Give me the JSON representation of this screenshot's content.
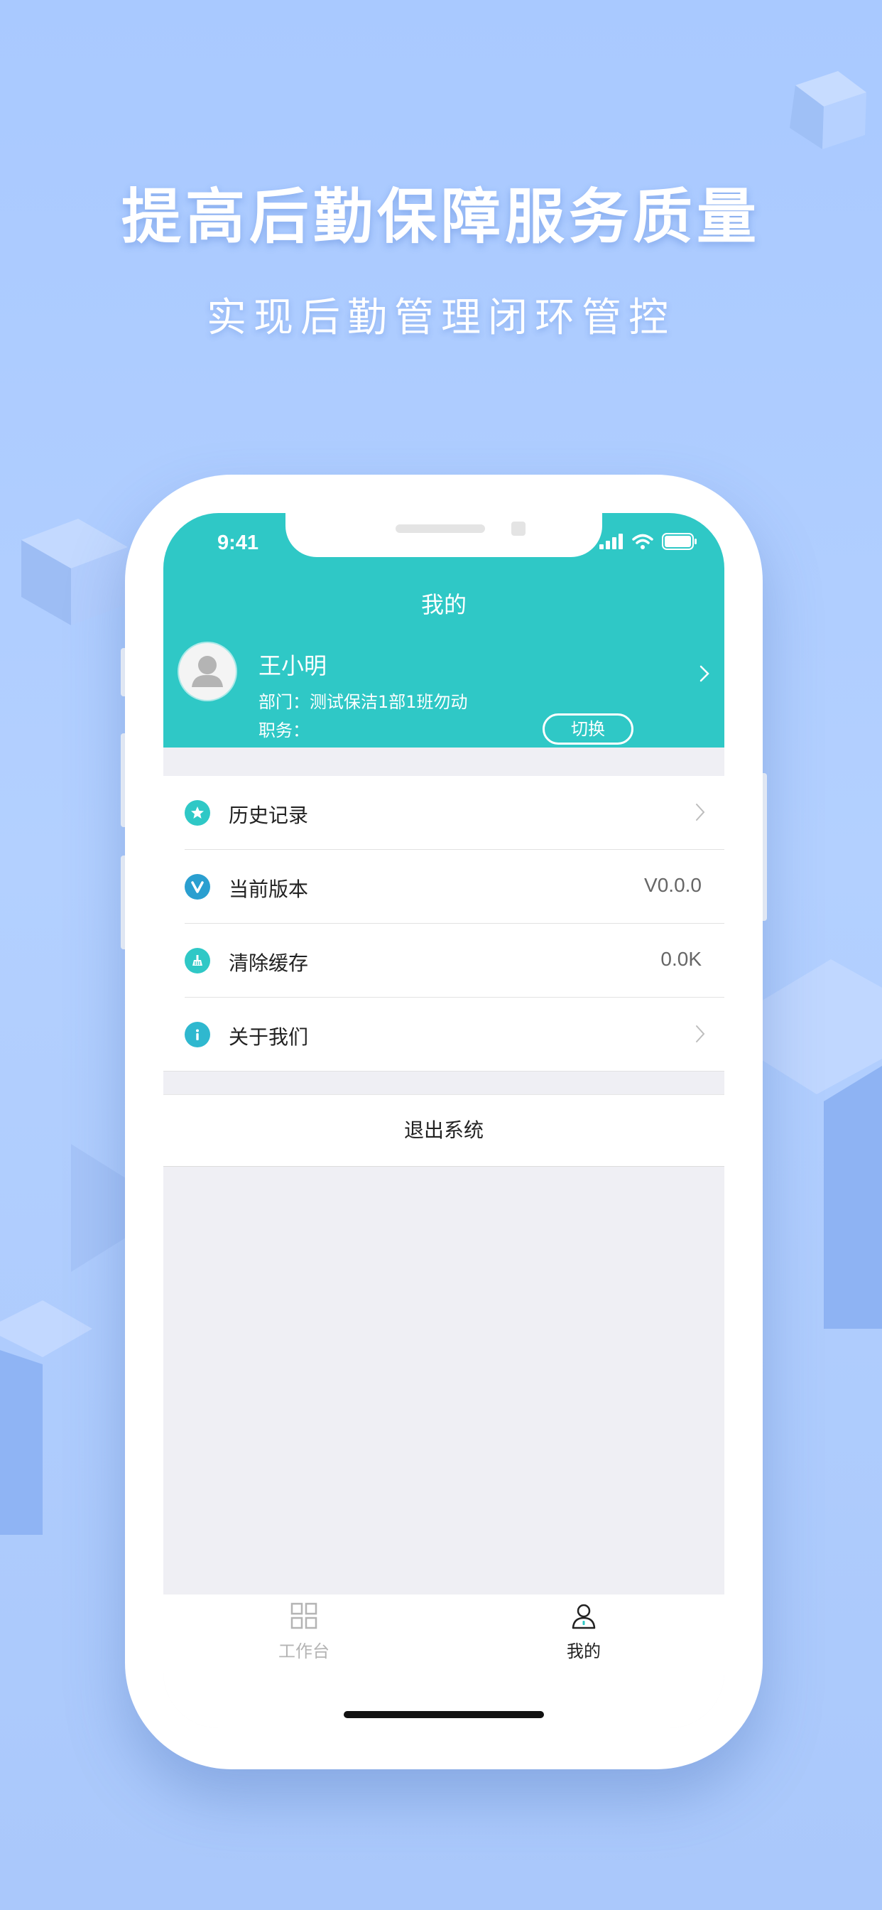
{
  "promo": {
    "headline": "提高后勤保障服务质量",
    "subline": "实现后勤管理闭环管控"
  },
  "status_bar": {
    "time": "9:41",
    "icons": [
      "signal-icon",
      "wifi-icon",
      "battery-icon"
    ]
  },
  "nav": {
    "title": "我的"
  },
  "profile": {
    "name": "王小明",
    "department": "部门：测试保洁1部1班勿动",
    "role": "职务：",
    "switch_label": "切换"
  },
  "menu": {
    "items": [
      {
        "label": "历史记录",
        "icon": "star-icon",
        "trailing": "chevron"
      },
      {
        "label": "当前版本",
        "icon": "version-icon",
        "value": "V0.0.0"
      },
      {
        "label": "清除缓存",
        "icon": "broom-icon",
        "value": "0.0K"
      },
      {
        "label": "关于我们",
        "icon": "info-icon",
        "trailing": "chevron"
      }
    ]
  },
  "logout_label": "退出系统",
  "tabbar": {
    "tabs": [
      {
        "label": "工作台",
        "icon": "grid-icon",
        "active": false
      },
      {
        "label": "我的",
        "icon": "user-icon",
        "active": true
      }
    ]
  },
  "colors": {
    "accent": "#2fc8c6",
    "background_blue": "#aecbff",
    "tab_active": "#222222",
    "tab_inactive": "#b4b4b4"
  }
}
